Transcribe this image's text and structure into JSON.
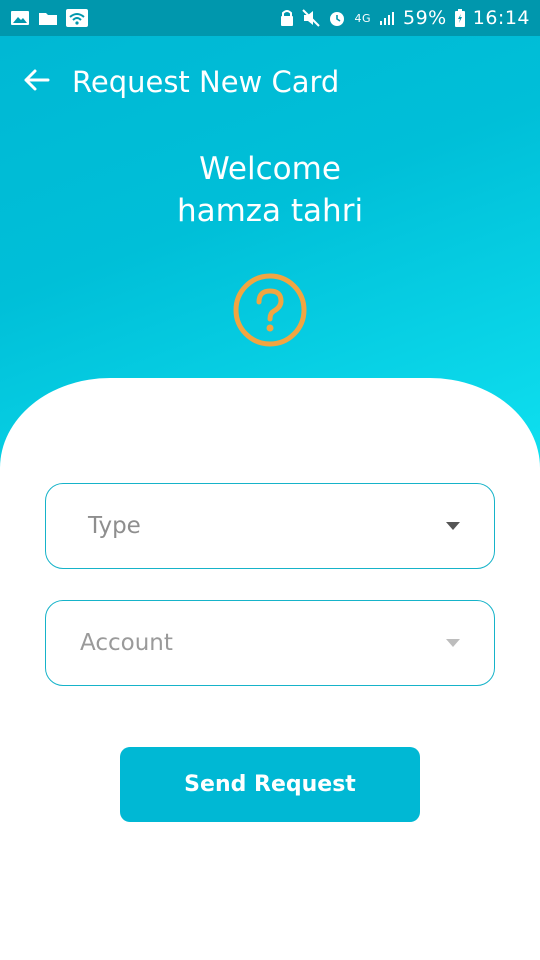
{
  "status_bar": {
    "battery": "59%",
    "time": "16:14",
    "network": "4G"
  },
  "header": {
    "title": "Request New Card",
    "welcome_line1": "Welcome",
    "welcome_line2": "hamza tahri"
  },
  "form": {
    "type_label": "Type",
    "account_label": "Account",
    "submit_label": "Send Request"
  },
  "colors": {
    "primary": "#00b8d4",
    "status_bar": "#0097ad",
    "help_icon": "#f2a541",
    "field_border": "#16b3c9"
  },
  "icons": [
    "gallery-icon",
    "folder-icon",
    "wifi-icon",
    "lock-icon",
    "mute-icon",
    "alarm-icon",
    "signal-icon",
    "battery-icon",
    "back-arrow-icon",
    "question-circle-icon",
    "dropdown-caret-icon"
  ]
}
